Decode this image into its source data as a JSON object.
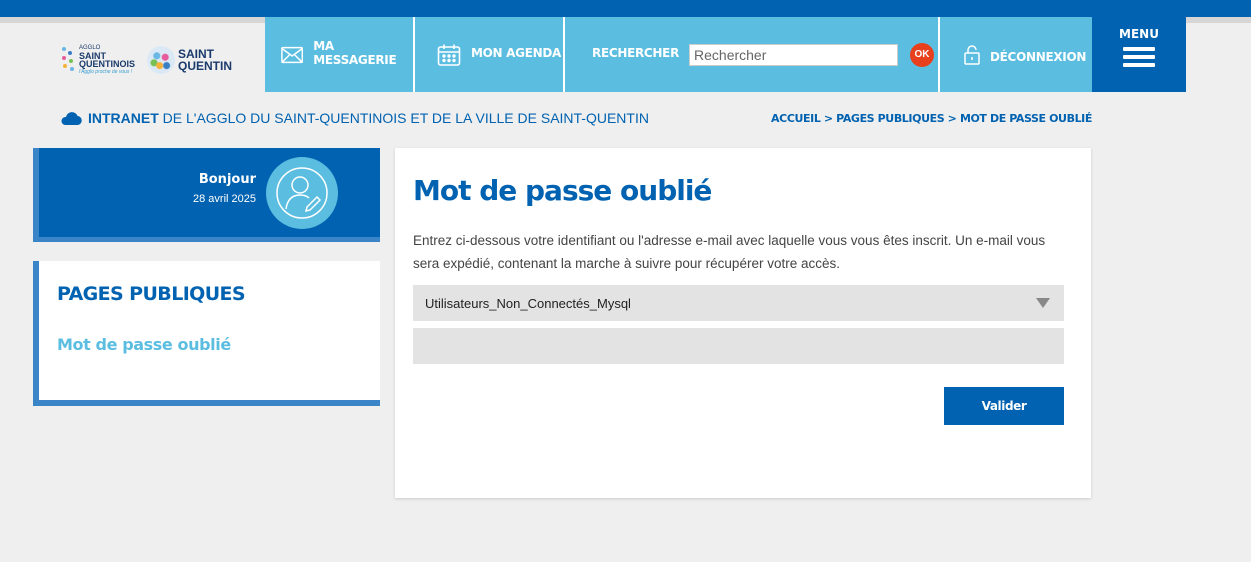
{
  "header": {
    "logo_agglo": {
      "line1": "AGGLO",
      "line2": "SAINT",
      "line3": "QUENTINOIS",
      "tagline": "l'Agglo proche de vous !"
    },
    "logo_sq": {
      "line1": "SAINT",
      "line2": "QUENTIN"
    },
    "nav": {
      "messagerie": "MA MESSAGERIE",
      "agenda": "MON AGENDA",
      "search_label": "RECHERCHER",
      "search_placeholder": "Rechercher",
      "search_ok": "OK",
      "logout": "DÉCONNEXION"
    },
    "menu_label": "MENU",
    "colors": {
      "primary": "#0062b0",
      "light": "#5bbde0",
      "accent": "#e8401c"
    }
  },
  "intranet": {
    "bold": "INTRANET",
    "rest": "DE L'AGGLO DU SAINT-QUENTINOIS ET DE LA VILLE DE SAINT-QUENTIN"
  },
  "breadcrumb": {
    "items": [
      "ACCUEIL",
      "PAGES PUBLIQUES",
      "MOT DE PASSE OUBLIÉ"
    ],
    "separator": ">"
  },
  "greeting": {
    "title": "Bonjour",
    "date": "28 avril 2025"
  },
  "sidebar": {
    "title": "PAGES PUBLIQUES",
    "items": [
      {
        "label": "Mot de passe oublié"
      }
    ]
  },
  "main": {
    "title": "Mot de passe oublié",
    "description": "Entrez ci-dessous votre identifiant ou l'adresse e-mail avec laquelle vous vous êtes inscrit. Un e-mail vous sera expédié, contenant la marche à suivre pour récupérer votre accès.",
    "select_value": "Utilisateurs_Non_Connectés_Mysql",
    "identifier_value": "",
    "submit_label": "Valider"
  }
}
